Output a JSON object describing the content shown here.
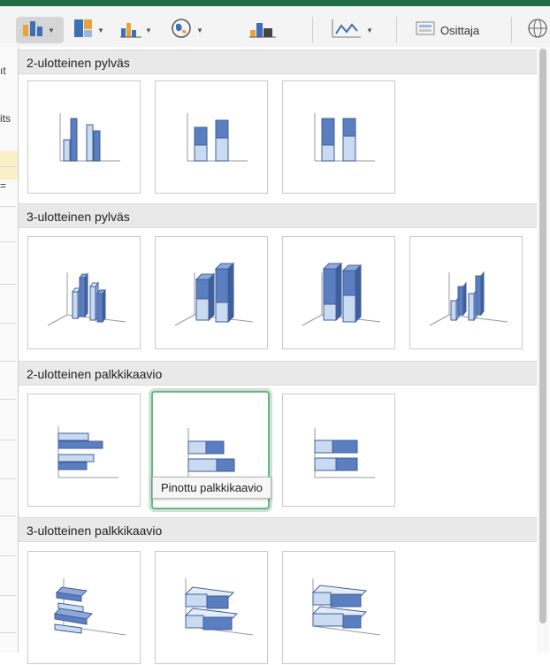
{
  "ribbon": {
    "buttons": [
      {
        "name": "column-chart-button",
        "icon": "column-chart-icon",
        "active": true
      },
      {
        "name": "hierarchy-chart-button",
        "icon": "treemap-chart-icon"
      },
      {
        "name": "statistic-chart-button",
        "icon": "histogram-chart-icon"
      },
      {
        "name": "maps-chart-button",
        "icon": "globe-map-icon"
      },
      {
        "name": "pivot-chart-button",
        "icon": "pivot-chart-icon"
      },
      {
        "name": "sparkline-button",
        "icon": "sparkline-line-icon"
      },
      {
        "name": "slicer-button",
        "icon": "slicer-icon",
        "label": "Osittaja"
      },
      {
        "name": "link-button",
        "icon": "globe-link-icon"
      }
    ]
  },
  "left_strip": {
    "texts": [
      "ıt",
      "its",
      "="
    ]
  },
  "sections": [
    {
      "label": "2-ulotteinen pylväs"
    },
    {
      "label": "3-ulotteinen pylväs"
    },
    {
      "label": "2-ulotteinen palkkikaavio"
    },
    {
      "label": "3-ulotteinen palkkikaavio"
    }
  ],
  "tiles": {
    "column2d": [
      "clustered-column",
      "stacked-column",
      "100-stacked-column"
    ],
    "column3d": [
      "3d-clustered-column",
      "3d-stacked-column",
      "3d-100-stacked-column",
      "3d-column"
    ],
    "bar2d": [
      "clustered-bar",
      "stacked-bar",
      "100-stacked-bar"
    ],
    "bar3d": [
      "3d-clustered-bar",
      "3d-stacked-bar",
      "3d-100-stacked-bar"
    ]
  },
  "selected_tile": "stacked-bar",
  "tooltip": {
    "text": "Pinottu palkkikaavio"
  },
  "colors": {
    "dark_fill": "#5b7ec0",
    "light_fill": "#c9daf1",
    "stroke": "#3f5f9c",
    "selection": "#6bb388",
    "accent_bar": "#1e6e42"
  }
}
